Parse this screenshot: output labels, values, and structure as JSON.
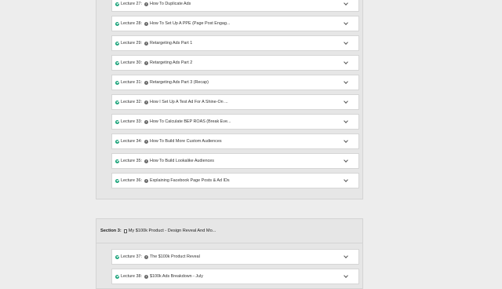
{
  "section_a": {
    "lectures": [
      {
        "num": "Lecture 27:",
        "title": "How To Duplicate Ads"
      },
      {
        "num": "Lecture 28:",
        "title": "How To Set Up A PPE (Page Post Engag..."
      },
      {
        "num": "Lecture 29:",
        "title": "Retargeting Ads Part 1"
      },
      {
        "num": "Lecture 30:",
        "title": "Retargeting Ads Part 2"
      },
      {
        "num": "Lecture 31:",
        "title": "Retargeting Ads Part 3 (Recap)"
      },
      {
        "num": "Lecture 32:",
        "title": "How I Set Up A Test Ad For A Shine-On ..."
      },
      {
        "num": "Lecture 33:",
        "title": "How To Calculate BEP ROAS (Break Eve..."
      },
      {
        "num": "Lecture 34:",
        "title": "How To Build More Custom Audiences"
      },
      {
        "num": "Lecture 35:",
        "title": "How To Build Lookalike Audiences"
      },
      {
        "num": "Lecture 36:",
        "title": "Explaining Facebook Page Posts & Ad IDs"
      }
    ]
  },
  "section_b": {
    "label": "Section 3:",
    "title": "My $100k Product - Design Reveal And Mo...",
    "lectures": [
      {
        "num": "Lecture 37:",
        "title": "The $100k Product Reveal"
      },
      {
        "num": "Lecture 38:",
        "title": "$100k Ads Breakdown - July"
      }
    ]
  },
  "colors": {
    "completed_check": "#1aa37a",
    "panel_bg": "#e6e6e6",
    "row_bg": "#ffffff"
  },
  "icons": {
    "completed": "check-circle-icon",
    "video": "play-circle-icon",
    "expand": "chevron-down-icon",
    "section": "document-icon"
  }
}
